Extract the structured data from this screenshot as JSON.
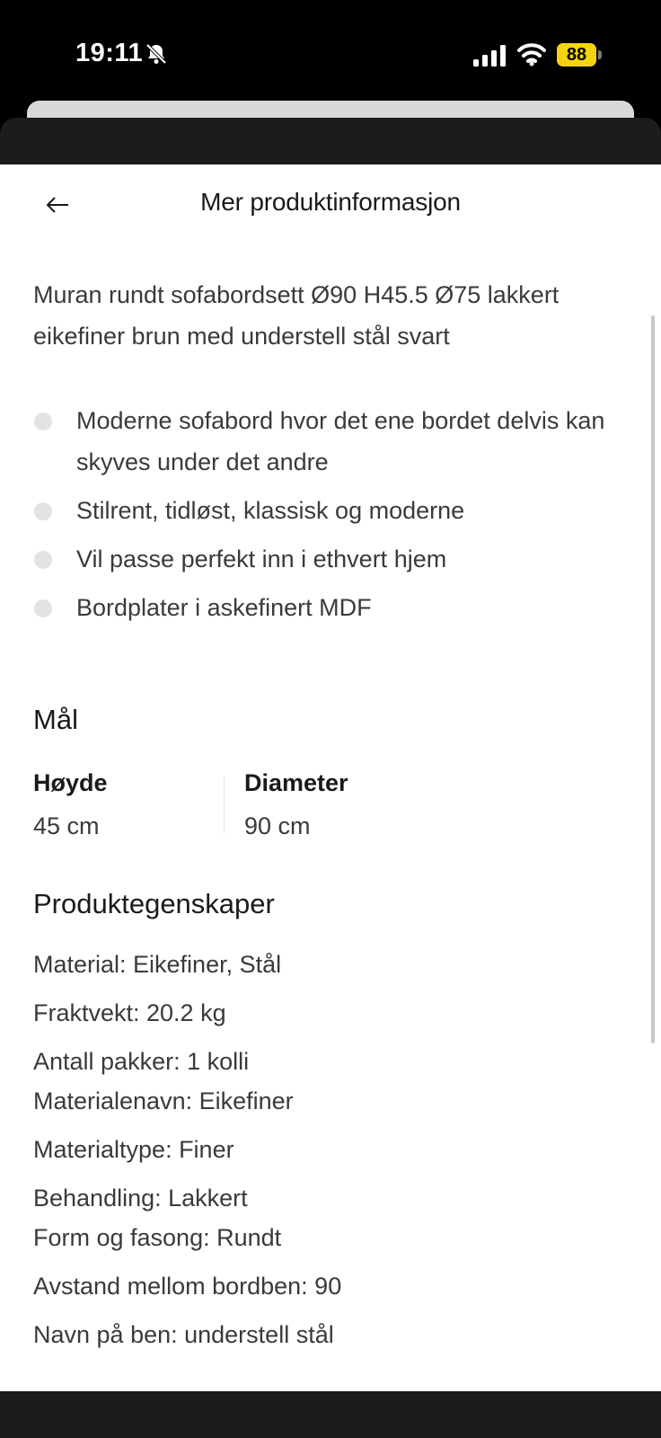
{
  "status_bar": {
    "time": "19:11",
    "battery": "88",
    "icons": [
      "bell-slash-icon",
      "cellular-signal-icon",
      "wifi-icon",
      "battery-icon"
    ]
  },
  "header": {
    "back_icon": "arrow-left-icon",
    "title": "Mer produktinformasjon"
  },
  "description": "Muran rundt sofabordsett Ø90 H45.5 Ø75 lakkert eikefiner brun med understell stål svart",
  "features": [
    "Moderne sofabord hvor det ene bordet delvis kan skyves under det andre",
    "Stilrent, tidløst, klassisk og moderne",
    "Vil passe perfekt inn i ethvert hjem",
    "Bordplater i askefinert MDF"
  ],
  "dimensions": {
    "heading": "Mål",
    "items": [
      {
        "label": "Høyde",
        "value": "45 cm"
      },
      {
        "label": "Diameter",
        "value": "90 cm"
      }
    ]
  },
  "properties": {
    "heading": "Produktegenskaper",
    "lines": [
      "Material: Eikefiner, Stål",
      "Fraktvekt: 20.2 kg",
      "Antall pakker: 1 kolli",
      "Materialenavn: Eikefiner",
      "Materialtype: Finer",
      "Behandling: Lakkert",
      "Form og fasong: Rundt",
      "Avstand mellom bordben: 90",
      "Navn på ben: understell stål"
    ]
  },
  "colors": {
    "panel_bg": "#ffffff",
    "text_dark": "#1a1a1a",
    "text_body": "#3a3a3a",
    "bullet": "#e3e3e3",
    "battery": "#f5d40f"
  }
}
